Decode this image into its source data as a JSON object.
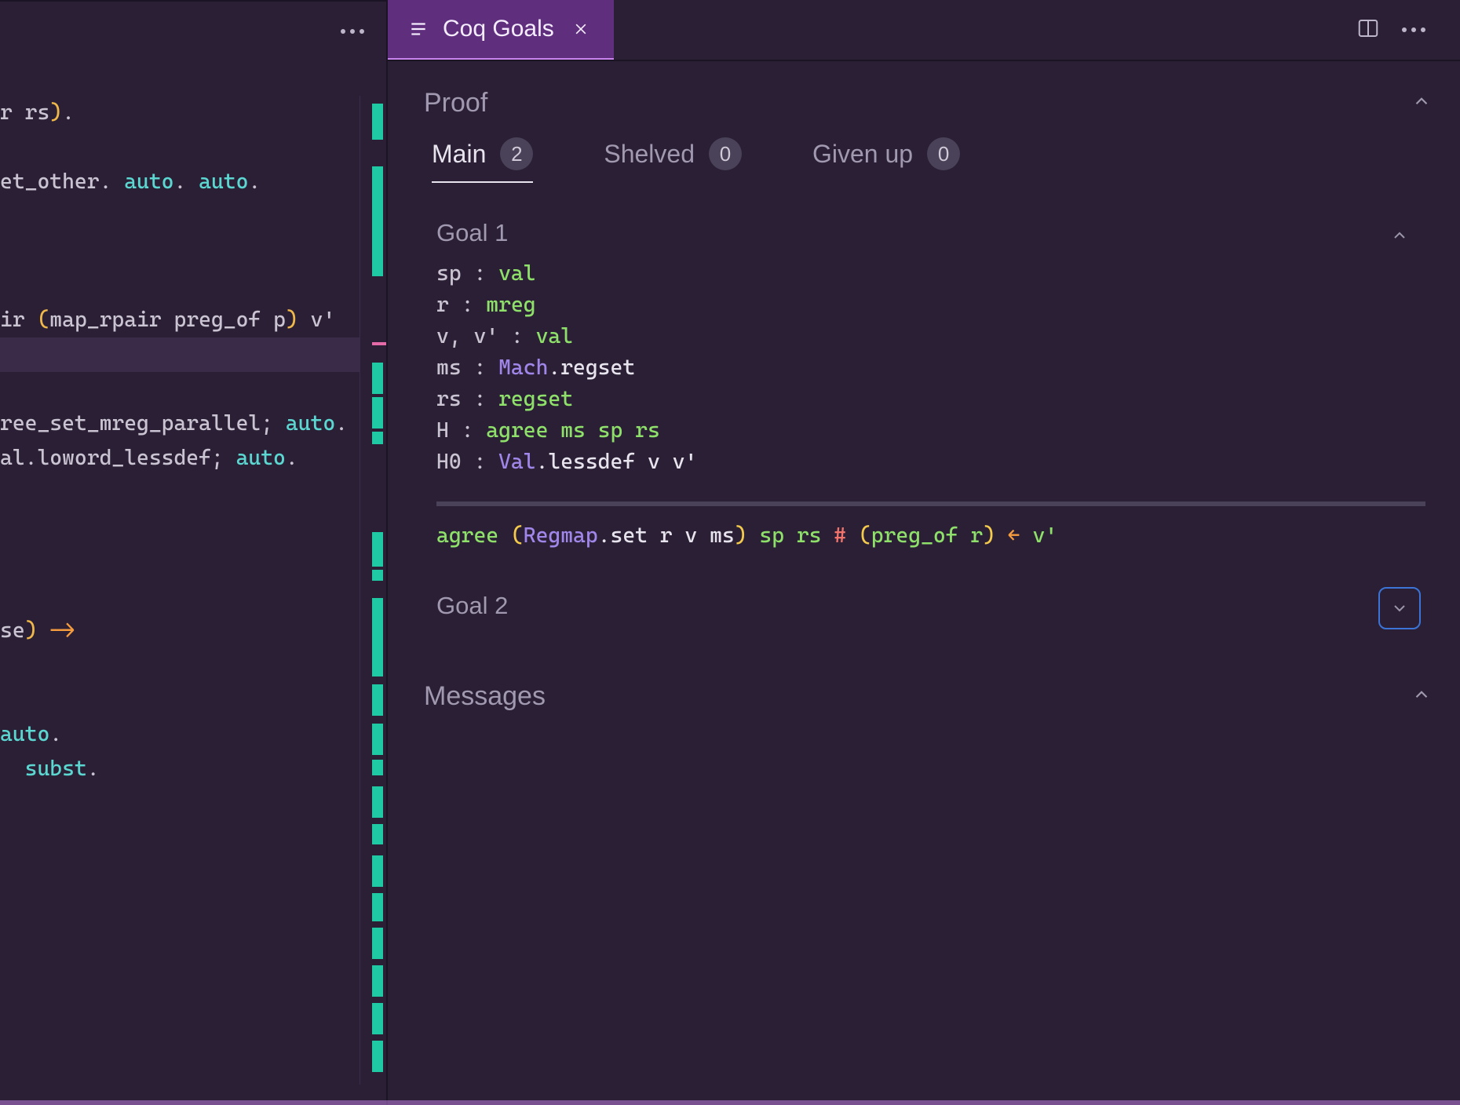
{
  "panel": {
    "tab_title": "Coq Goals",
    "sections": {
      "proof_title": "Proof",
      "messages_title": "Messages"
    },
    "goal_classes": [
      {
        "label": "Main",
        "count": "2",
        "active": true
      },
      {
        "label": "Shelved",
        "count": "0",
        "active": false
      },
      {
        "label": "Given up",
        "count": "0",
        "active": false
      }
    ],
    "goals": [
      {
        "title": "Goal 1",
        "expanded": true,
        "hypotheses": [
          {
            "name": "sp",
            "sep": " : ",
            "type_tokens": [
              {
                "t": "val",
                "c": "t-green"
              }
            ]
          },
          {
            "name": "r",
            "sep": " : ",
            "type_tokens": [
              {
                "t": "mreg",
                "c": "t-green"
              }
            ]
          },
          {
            "name": "v, v'",
            "sep": " : ",
            "type_tokens": [
              {
                "t": "val",
                "c": "t-green"
              }
            ]
          },
          {
            "name": "ms",
            "sep": " : ",
            "type_tokens": [
              {
                "t": "Mach",
                "c": "t-mod"
              },
              {
                "t": ".regset",
                "c": "t-white"
              }
            ]
          },
          {
            "name": "rs",
            "sep": " : ",
            "type_tokens": [
              {
                "t": "regset",
                "c": "t-green"
              }
            ]
          },
          {
            "name": "H",
            "sep": " : ",
            "type_tokens": [
              {
                "t": "agree ms sp rs",
                "c": "t-green"
              }
            ]
          },
          {
            "name": "H0",
            "sep": " : ",
            "type_tokens": [
              {
                "t": "Val",
                "c": "t-mod"
              },
              {
                "t": ".lessdef v v'",
                "c": "t-white"
              }
            ]
          }
        ],
        "conclusion_tokens": [
          {
            "t": "agree",
            "c": "t-green"
          },
          {
            "t": " ",
            "c": "t-white"
          },
          {
            "t": "(",
            "c": "t-yel"
          },
          {
            "t": "Regmap",
            "c": "t-mod"
          },
          {
            "t": ".set r v ms",
            "c": "t-white"
          },
          {
            "t": ")",
            "c": "t-yel"
          },
          {
            "t": " sp rs ",
            "c": "t-green"
          },
          {
            "t": "#",
            "c": "t-red"
          },
          {
            "t": " ",
            "c": "t-white"
          },
          {
            "t": "(",
            "c": "t-yel"
          },
          {
            "t": "preg_of r",
            "c": "t-green"
          },
          {
            "t": ")",
            "c": "t-yel"
          },
          {
            "t": " ",
            "c": "t-white"
          },
          {
            "t": "←",
            "c": "t-or"
          },
          {
            "t": " v'",
            "c": "t-green"
          }
        ]
      },
      {
        "title": "Goal 2",
        "expanded": false
      }
    ]
  },
  "editor": {
    "lines": [
      "r rs).",
      "",
      "et_other. auto. auto.",
      "",
      "",
      "",
      "ir (map_rpair preg_of p) v'",
      "",
      "",
      "ree_set_mreg_parallel; auto.",
      "al.loword_lessdef; auto.",
      "",
      "",
      "",
      "",
      "se) ->",
      "",
      "",
      "auto.",
      "  subst."
    ]
  }
}
